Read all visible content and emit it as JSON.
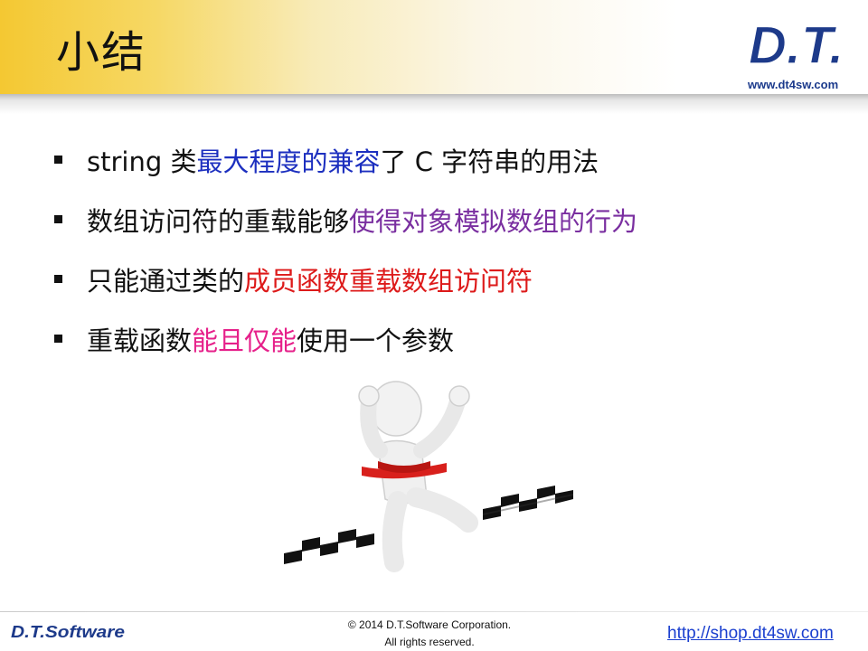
{
  "title": "小结",
  "logo": {
    "text": "D.T.",
    "url": "www.dt4sw.com"
  },
  "bullets": [
    {
      "parts": [
        {
          "text": "string 类",
          "color": "default"
        },
        {
          "text": "最大程度的兼容",
          "color": "blue"
        },
        {
          "text": "了 C 字符串的用法",
          "color": "default"
        }
      ]
    },
    {
      "parts": [
        {
          "text": "数组访问符的重载能够",
          "color": "default"
        },
        {
          "text": "使得对象模拟数组的行为",
          "color": "purple"
        }
      ]
    },
    {
      "parts": [
        {
          "text": "只能通过类的",
          "color": "default"
        },
        {
          "text": "成员函数重载数组访问符",
          "color": "red"
        }
      ]
    },
    {
      "parts": [
        {
          "text": "重载函数",
          "color": "default"
        },
        {
          "text": "能且仅能",
          "color": "pink"
        },
        {
          "text": "使用一个参数",
          "color": "default"
        }
      ]
    }
  ],
  "footer": {
    "logo_text": "D.T.Software",
    "copyright_line1": "© 2014 D.T.Software Corporation.",
    "copyright_line2": "All rights reserved.",
    "link": "http://shop.dt4sw.com"
  },
  "colors": {
    "blue": "#1c2fbf",
    "purple": "#7a2fa0",
    "red": "#dd1a1a",
    "pink": "#e6208a",
    "header": "#f4c832"
  }
}
